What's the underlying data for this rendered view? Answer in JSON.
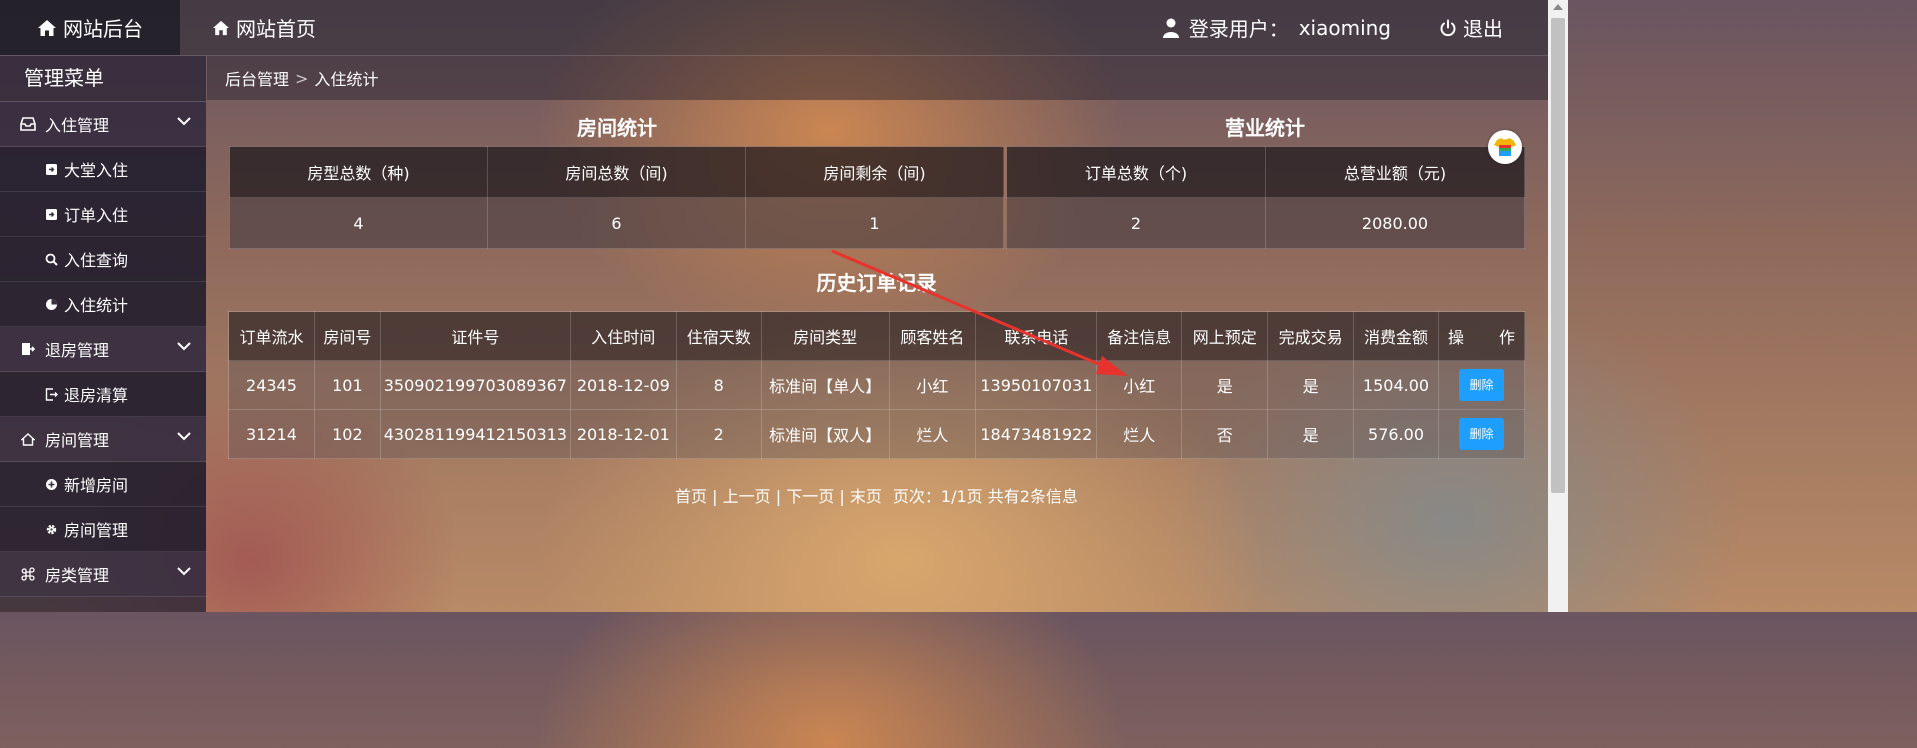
{
  "topbar": {
    "brand": "网站后台",
    "home": "网站首页",
    "user_label": "登录用户：",
    "username": "xiaoming",
    "logout": "退出"
  },
  "sidebar": {
    "title": "管理菜单",
    "groups": [
      {
        "label": "入住管理",
        "icon": "inbox-icon",
        "items": [
          {
            "label": "大堂入住",
            "icon": "sign-in-icon"
          },
          {
            "label": "订单入住",
            "icon": "sign-in-icon"
          },
          {
            "label": "入住查询",
            "icon": "search-icon"
          },
          {
            "label": "入住统计",
            "icon": "pie-chart-icon"
          }
        ]
      },
      {
        "label": "退房管理",
        "icon": "sign-out-icon",
        "items": [
          {
            "label": "退房清算",
            "icon": "sign-out-icon"
          }
        ]
      },
      {
        "label": "房间管理",
        "icon": "home-icon",
        "items": [
          {
            "label": "新增房间",
            "icon": "plus-circle-icon"
          },
          {
            "label": "房间管理",
            "icon": "gear-icon"
          }
        ]
      },
      {
        "label": "房类管理",
        "icon": "command-icon",
        "items": []
      }
    ]
  },
  "breadcrumb": {
    "root": "后台管理",
    "separator": ">",
    "current": "入住统计"
  },
  "room_stats": {
    "title": "房间统计",
    "headers": [
      "房型总数（种)",
      "房间总数（间)",
      "房间剩余（间)"
    ],
    "values": [
      "4",
      "6",
      "1"
    ]
  },
  "business_stats": {
    "title": "营业统计",
    "headers": [
      "订单总数（个)",
      "总营业额（元)"
    ],
    "values": [
      "2",
      "2080.00"
    ]
  },
  "orders": {
    "title": "历史订单记录",
    "headers": [
      "订单流水",
      "房间号",
      "证件号",
      "入住时间",
      "住宿天数",
      "房间类型",
      "顾客姓名",
      "联系电话",
      "备注信息",
      "网上预定",
      "完成交易",
      "消费金额",
      "操",
      "作"
    ],
    "rows": [
      [
        "24345",
        "101",
        "350902199703089367",
        "2018-12-09",
        "8",
        "标准间【单人】",
        "小红",
        "13950107031",
        "小红",
        "是",
        "是",
        "1504.00"
      ],
      [
        "31214",
        "102",
        "430281199412150313",
        "2018-12-01",
        "2",
        "标准间【双人】",
        "烂人",
        "18473481922",
        "烂人",
        "否",
        "是",
        "576.00"
      ]
    ],
    "delete_label": "删除"
  },
  "pager": {
    "first": "首页",
    "prev": "上一页",
    "next": "下一页",
    "last": "末页",
    "sep": "|",
    "info": "页次：1/1页 共有2条信息"
  },
  "colors": {
    "accent": "#1e9fff",
    "annotation_arrow": "#e8322d"
  }
}
